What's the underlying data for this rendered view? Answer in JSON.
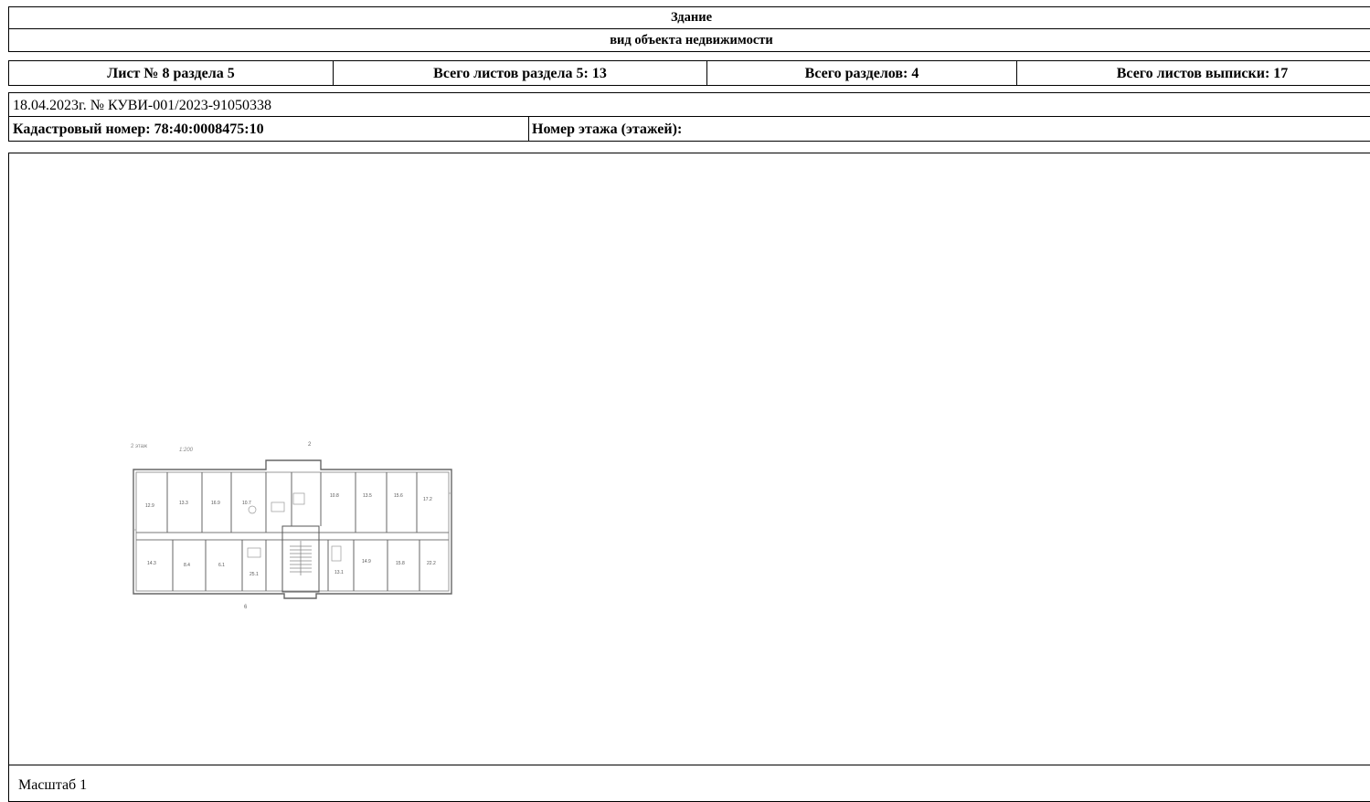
{
  "header": {
    "title": "Здание",
    "subtitle": "вид объекта недвижимости"
  },
  "sheet_info": {
    "sheet_no": "Лист № 8 раздела 5",
    "total_sheets_section": "Всего листов раздела 5: 13",
    "total_sections": "Всего разделов: 4",
    "total_sheets_extract": "Всего листов выписки: 17"
  },
  "document": {
    "date_number": "18.04.2023г. № КУВИ-001/2023-91050338",
    "cadastral_number": "Кадастровый номер: 78:40:0008475:10",
    "floor_number": "Номер этажа (этажей):"
  },
  "plan": {
    "floor_label": "2 этаж",
    "scale_mark": "1:200",
    "axis_top": "2",
    "axis_bottom": "6",
    "room_areas": [
      "12.9",
      "13.3",
      "16.9",
      "10.7",
      "10.8",
      "13.5",
      "15.6",
      "17.2",
      "14.3",
      "8.4",
      "6.1",
      "25.1",
      "13.1",
      "14.9",
      "15.8",
      "22.2"
    ]
  },
  "footer": {
    "scale": "Масштаб 1"
  }
}
